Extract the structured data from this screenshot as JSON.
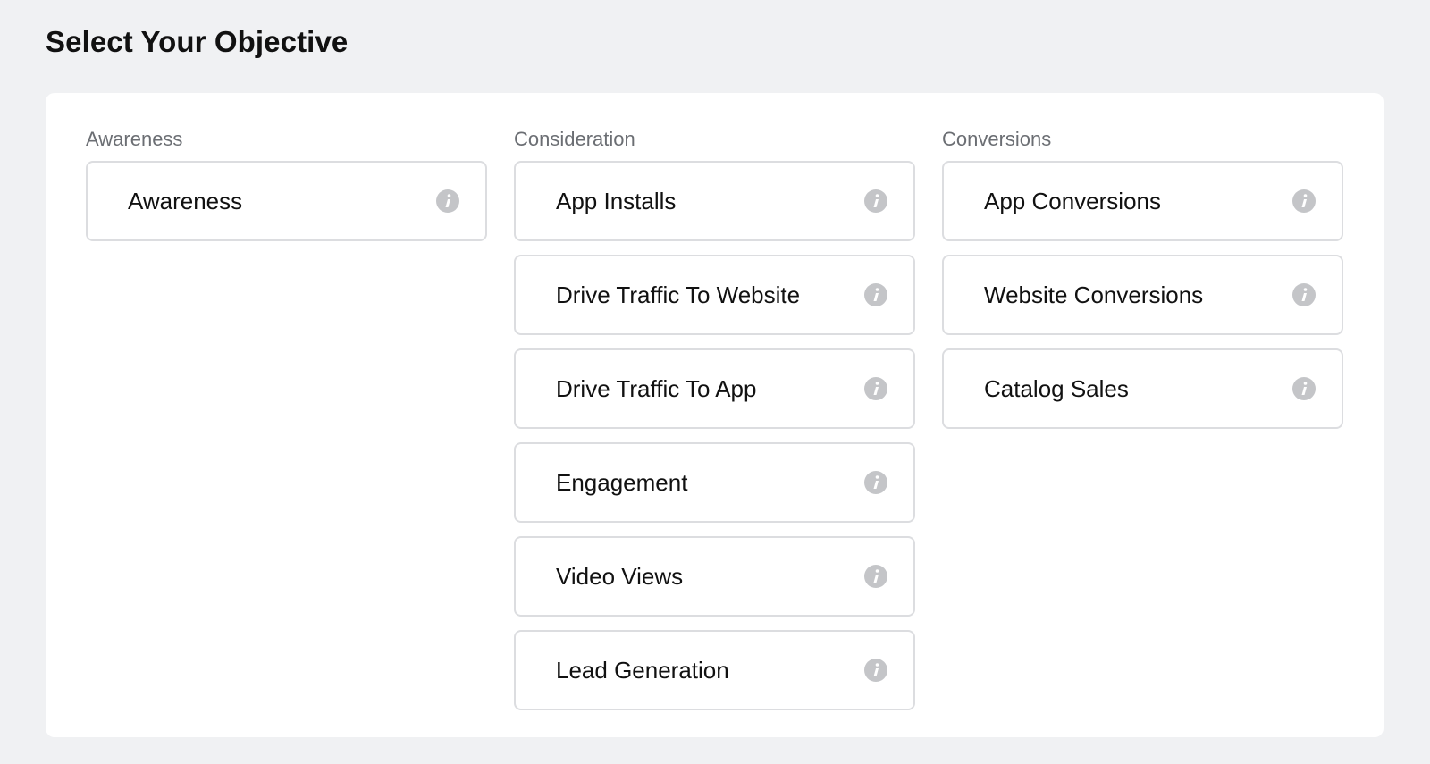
{
  "page": {
    "title": "Select Your Objective"
  },
  "colors": {
    "background": "#f0f1f3",
    "panel": "#ffffff",
    "card_border": "#dcdde0",
    "heading_gray": "#6b6e73",
    "info_icon": "#c4c5c8"
  },
  "columns": [
    {
      "heading": "Awareness",
      "options": [
        {
          "label": "Awareness",
          "icon": "info-icon"
        }
      ]
    },
    {
      "heading": "Consideration",
      "options": [
        {
          "label": "App Installs",
          "icon": "info-icon"
        },
        {
          "label": "Drive Traffic To Website",
          "icon": "info-icon"
        },
        {
          "label": "Drive Traffic To App",
          "icon": "info-icon"
        },
        {
          "label": "Engagement",
          "icon": "info-icon"
        },
        {
          "label": "Video Views",
          "icon": "info-icon"
        },
        {
          "label": "Lead Generation",
          "icon": "info-icon"
        }
      ]
    },
    {
      "heading": "Conversions",
      "options": [
        {
          "label": "App Conversions",
          "icon": "info-icon"
        },
        {
          "label": "Website Conversions",
          "icon": "info-icon"
        },
        {
          "label": "Catalog Sales",
          "icon": "info-icon"
        }
      ]
    }
  ]
}
